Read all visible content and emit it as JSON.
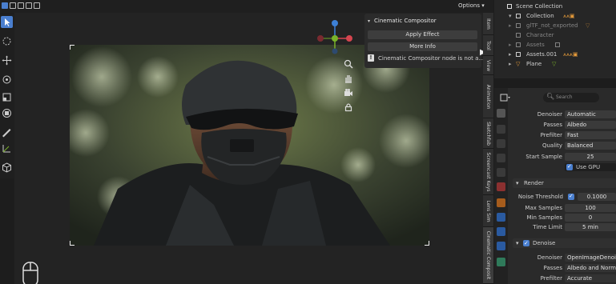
{
  "viewport": {
    "options_label": "Options"
  },
  "popover": {
    "title": "Cinematic Compositor",
    "apply_label": "Apply Effect",
    "more_label": "More Info",
    "info_text": "Cinematic Compositor node is not a..."
  },
  "vertical_tabs": [
    "Item",
    "Tool",
    "View",
    "Animation",
    "Sketchfab",
    "Screencast Keys",
    "Lens Sim",
    "Cinematic Composit"
  ],
  "outliner": {
    "rows": [
      {
        "label": "Scene Collection"
      },
      {
        "label": "Collection"
      },
      {
        "label": "glTF_not_exported"
      },
      {
        "label": "Character"
      },
      {
        "label": "Assets"
      },
      {
        "label": "Assets.001"
      },
      {
        "label": "Plane"
      }
    ]
  },
  "properties": {
    "search_placeholder": "Search",
    "rows": [
      {
        "label": "Denoiser",
        "value": "Automatic"
      },
      {
        "label": "Passes",
        "value": "Albedo"
      },
      {
        "label": "Prefilter",
        "value": "Fast"
      },
      {
        "label": "Quality",
        "value": "Balanced"
      },
      {
        "label": "Start Sample",
        "value": "25"
      }
    ],
    "use_gpu_label": "Use GPU",
    "render_section": "Render",
    "noise_threshold": {
      "label": "Noise Threshold",
      "value": "0.1000"
    },
    "render_rows": [
      {
        "label": "Max Samples",
        "value": "100"
      },
      {
        "label": "Min Samples",
        "value": "0"
      },
      {
        "label": "Time Limit",
        "value": "5 min"
      }
    ],
    "denoise_section": "Denoise",
    "denoise_rows": [
      {
        "label": "Denoiser",
        "value": "OpenImageDenoi"
      },
      {
        "label": "Passes",
        "value": "Albedo and Norm"
      },
      {
        "label": "Prefilter",
        "value": "Accurate"
      }
    ]
  },
  "colors": {
    "accent": "#4a7fcf",
    "x_axis": "#d5454f",
    "y_axis": "#79b229",
    "z_axis": "#3d80d6"
  }
}
